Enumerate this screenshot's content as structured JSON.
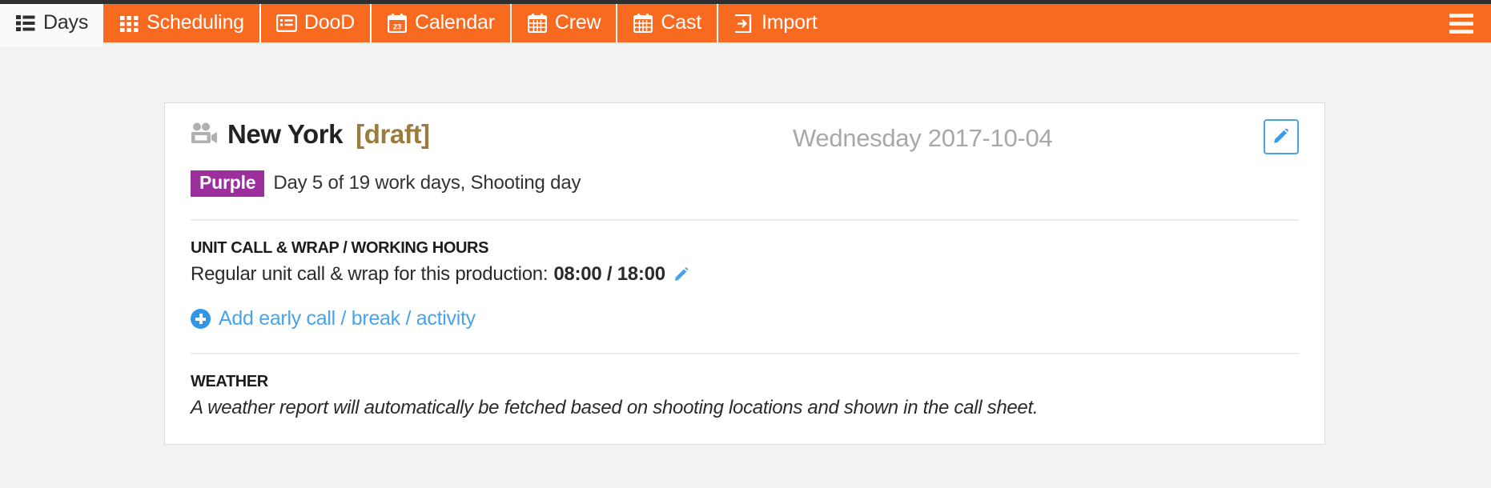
{
  "theme": {
    "accent_orange": "#f96a21",
    "link_blue": "#4aa3e8",
    "badge_purple": "#9c2f9c",
    "draft_brown": "#9a7c3e",
    "page_bg": "#f2f2f2"
  },
  "navbar": {
    "items": [
      {
        "label": "Days",
        "icon": "list-ul-icon",
        "active": true
      },
      {
        "label": "Scheduling",
        "icon": "grid-dots-icon",
        "active": false
      },
      {
        "label": "DooD",
        "icon": "list-alt-icon",
        "active": false
      },
      {
        "label": "Calendar",
        "icon": "calendar-date-icon",
        "active": false
      },
      {
        "label": "Crew",
        "icon": "calendar-grid-icon",
        "active": false
      },
      {
        "label": "Cast",
        "icon": "calendar-grid-icon",
        "active": false
      },
      {
        "label": "Import",
        "icon": "sign-in-icon",
        "active": false
      }
    ],
    "menu_icon": "hamburger-icon"
  },
  "card": {
    "production_icon": "video-camera-icon",
    "production_title": "New York",
    "status_tag": "[draft]",
    "date": "Wednesday 2017-10-04",
    "edit_button_icon": "pencil-icon",
    "badge": "Purple",
    "day_info": "Day 5 of 19 work days, Shooting day",
    "unit_call": {
      "heading": "UNIT CALL & WRAP / WORKING HOURS",
      "label": "Regular unit call & wrap for this production:",
      "value": "08:00 / 18:00",
      "edit_icon": "pencil-icon"
    },
    "add_link": {
      "icon": "plus-circle-icon",
      "label": "Add early call / break / activity"
    },
    "weather": {
      "heading": "WEATHER",
      "text": "A weather report will automatically be fetched based on shooting locations and shown in the call sheet."
    }
  }
}
